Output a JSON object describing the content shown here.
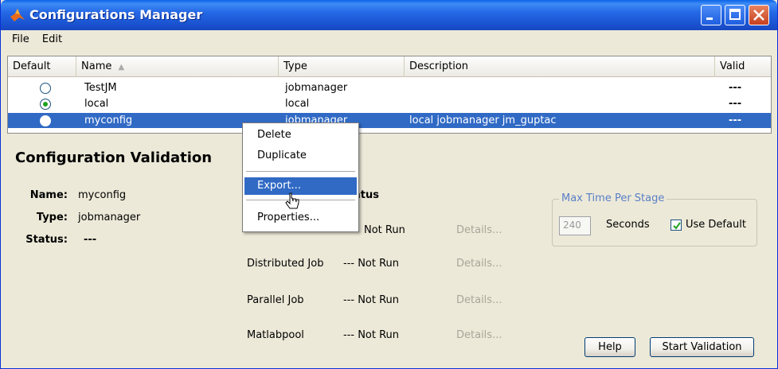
{
  "window": {
    "title": "Configurations Manager"
  },
  "menu": [
    "File",
    "Edit"
  ],
  "table": {
    "columns": [
      "Default",
      "Name",
      "Type",
      "Description",
      "Valid"
    ],
    "sort_indicator": "▲",
    "rows": [
      {
        "name": "TestJM",
        "type": "jobmanager",
        "description": "",
        "valid": "---",
        "default": false,
        "selected": false
      },
      {
        "name": "local",
        "type": "local",
        "description": "",
        "valid": "---",
        "default": true,
        "selected": false
      },
      {
        "name": "myconfig",
        "type": "jobmanager",
        "description": "local jobmanager jm_guptac",
        "valid": "---",
        "default": false,
        "selected": true
      }
    ]
  },
  "validation": {
    "title": "Configuration Validation",
    "name_label": "Name:",
    "name_value": "myconfig",
    "type_label": "Type:",
    "type_value": "jobmanager",
    "status_label": "Status:",
    "status_value": "---",
    "status_header": "atus",
    "stages": [
      {
        "name": "",
        "status": "Not Run",
        "details": "Details..."
      },
      {
        "name": "Distributed Job",
        "status": "--- Not Run",
        "details": "Details..."
      },
      {
        "name": "Parallel Job",
        "status": "--- Not Run",
        "details": "Details..."
      },
      {
        "name": "Matlabpool",
        "status": "--- Not Run",
        "details": "Details..."
      }
    ],
    "max_time": {
      "title": "Max Time Per Stage",
      "value": "240",
      "unit": "Seconds",
      "use_default_label": "Use Default",
      "use_default_checked": true
    },
    "help_label": "Help",
    "start_label": "Start Validation"
  },
  "context_menu": {
    "items": [
      "Delete",
      "Duplicate",
      "Export...",
      "Properties..."
    ],
    "highlighted": "Export..."
  }
}
